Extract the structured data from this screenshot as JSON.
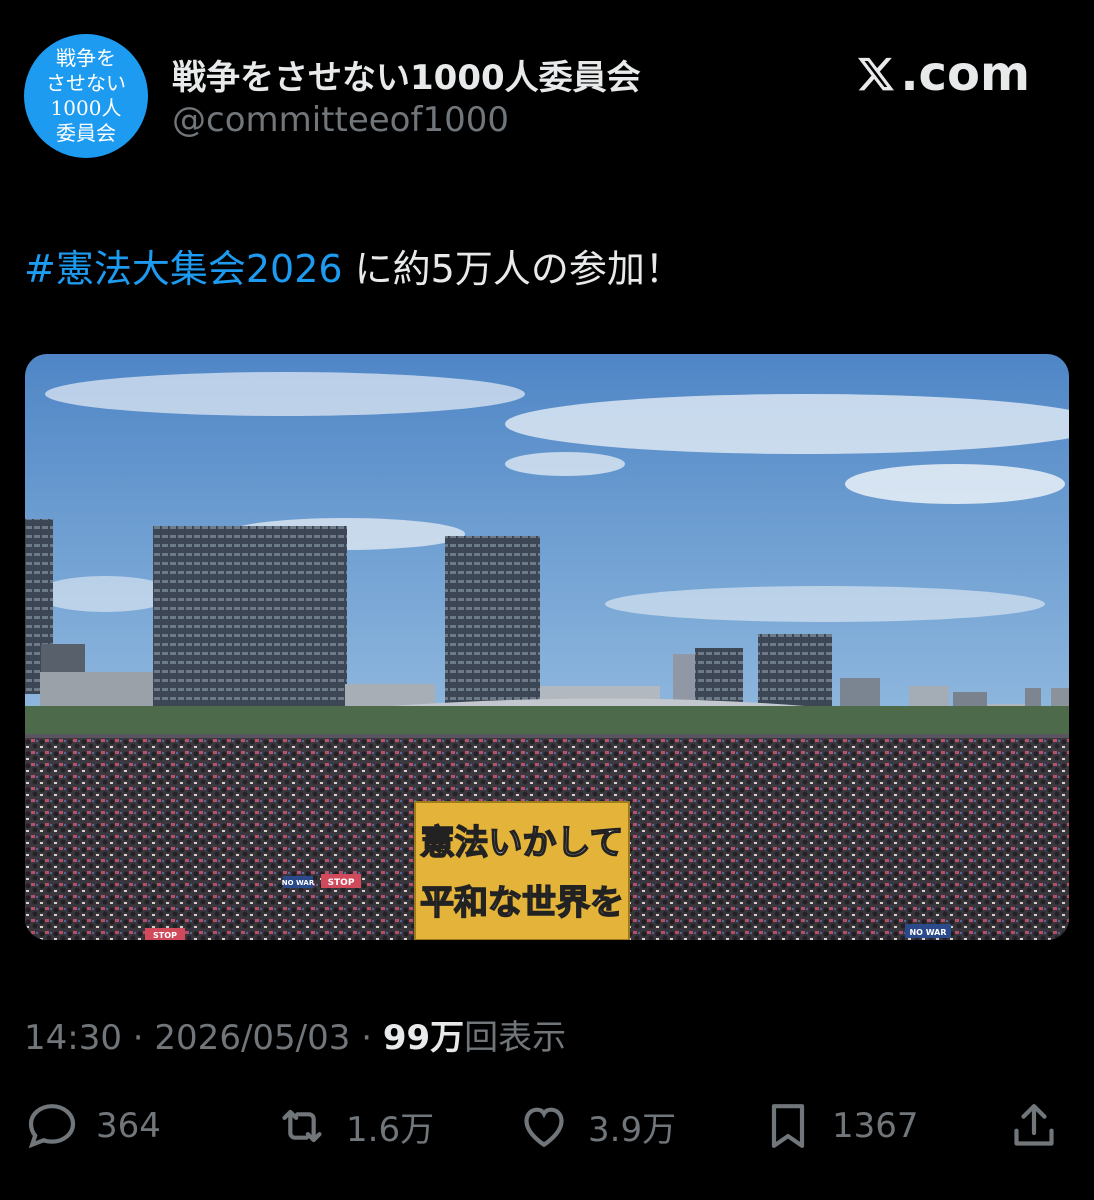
{
  "author": {
    "avatar_lines": [
      "戦争を",
      "させない",
      "1000人",
      "委員会"
    ],
    "display_name": "戦争をさせない1000人委員会",
    "handle": "@committeeof1000"
  },
  "brand": {
    "label": ".com",
    "icon": "x-logo-icon"
  },
  "tweet": {
    "hashtag": "#憲法大集会2026",
    "text": " に約5万人の参加！"
  },
  "photo": {
    "sign_line1": "憲法いかして",
    "sign_line2": "平和な世界を",
    "crowd_placards": [
      "STOP",
      "NO WAR"
    ]
  },
  "meta": {
    "time": "14:30",
    "separator": " · ",
    "date": "2026/05/03",
    "views_number": "99万",
    "views_label": "回表示"
  },
  "actions": [
    {
      "icon": "reply-icon",
      "count": "364"
    },
    {
      "icon": "retweet-icon",
      "count": "1.6万"
    },
    {
      "icon": "like-icon",
      "count": "3.9万"
    },
    {
      "icon": "bookmark-icon",
      "count": "1367"
    },
    {
      "icon": "share-icon",
      "count": ""
    }
  ],
  "colors": {
    "background": "#000000",
    "text": "#e7e9ea",
    "secondary": "#71767b",
    "accent": "#1d9bf0"
  }
}
